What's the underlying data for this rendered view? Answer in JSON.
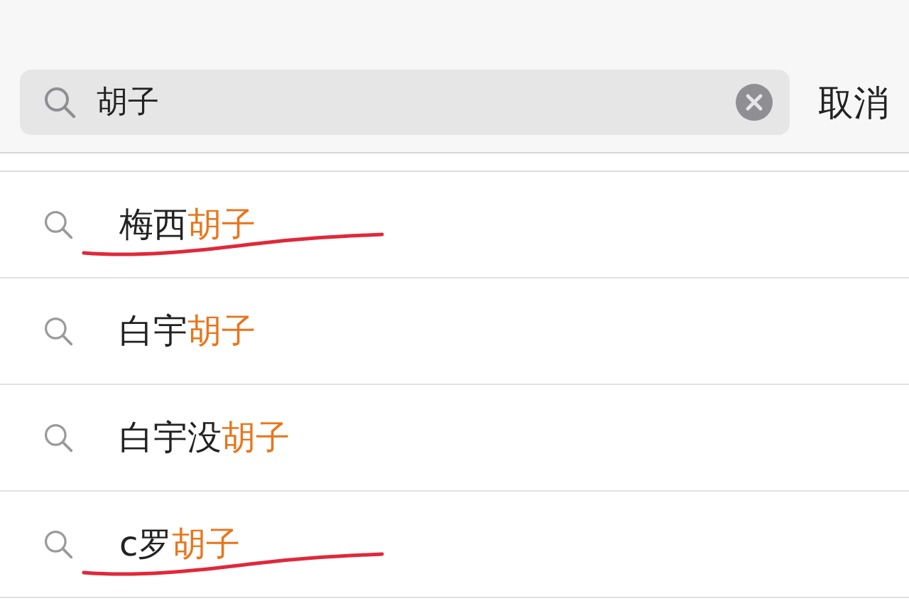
{
  "search": {
    "value": "胡子",
    "cancel": "取消"
  },
  "suggestions": [
    {
      "prefix": "梅西",
      "match": "胡子",
      "annotated": true
    },
    {
      "prefix": "白宇",
      "match": "胡子",
      "annotated": false
    },
    {
      "prefix": "白宇没",
      "match": "胡子",
      "annotated": false
    },
    {
      "prefix": "c罗",
      "match": "胡子",
      "annotated": true
    }
  ]
}
